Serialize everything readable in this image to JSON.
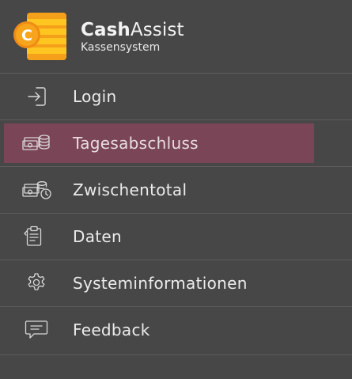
{
  "app": {
    "logo_letter": "C",
    "brand_bold": "Cash",
    "brand_light": "Assist",
    "subtitle": "Kassensystem"
  },
  "colors": {
    "background": "#474747",
    "divider": "#5c5c5c",
    "active_highlight": "#7b4558",
    "logo_orange": "#f7a21b",
    "logo_yellow": "#ffc61e",
    "icon_stroke": "#d8d8d8"
  },
  "menu": {
    "items": [
      {
        "label": "Login",
        "icon": "login-icon",
        "active": false
      },
      {
        "label": "Tagesabschluss",
        "icon": "cash-stack-icon",
        "active": true
      },
      {
        "label": "Zwischentotal",
        "icon": "cash-clock-icon",
        "active": false
      },
      {
        "label": "Daten",
        "icon": "clipboard-icon",
        "active": false
      },
      {
        "label": "Systeminformationen",
        "icon": "gear-icon",
        "active": false
      },
      {
        "label": "Feedback",
        "icon": "chat-bubble-icon",
        "active": false
      }
    ]
  }
}
